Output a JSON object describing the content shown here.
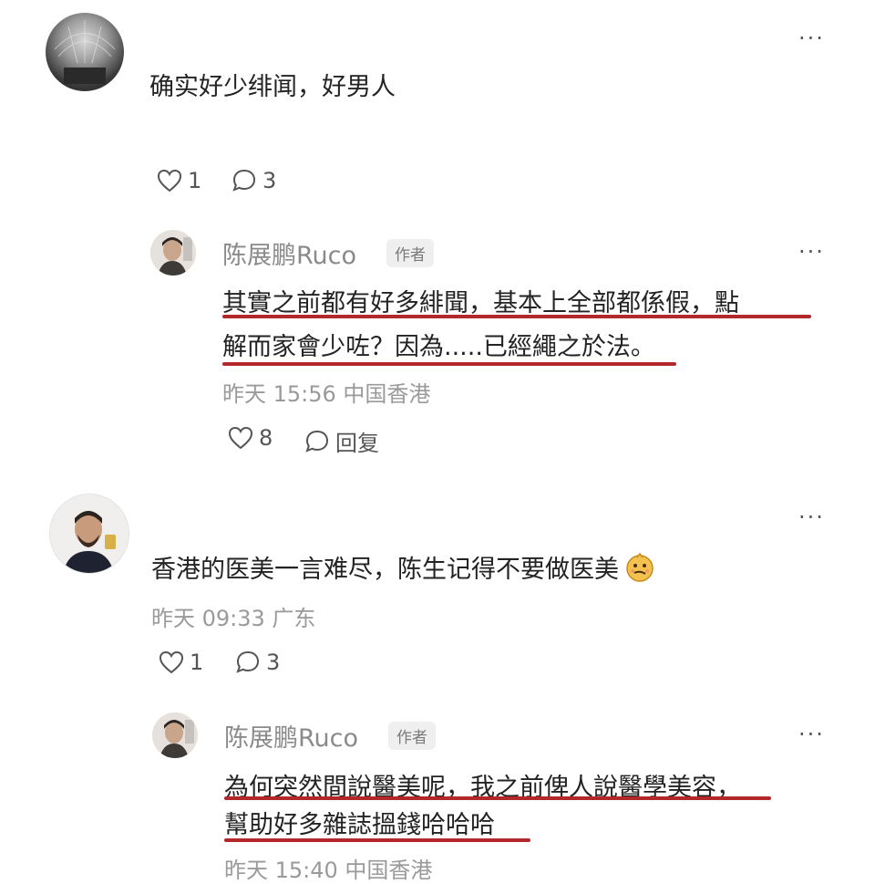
{
  "comments": [
    {
      "text": "确实好少绯闻，好男人",
      "likes": "1",
      "replies": "3",
      "more": "···",
      "reply": {
        "author": "陈展鹏Ruco",
        "badge": "作者",
        "line1": "其實之前都有好多緋聞，基本上全部都係假，點",
        "line2": "解而家會少咗？因為.....已經繩之於法。",
        "time": "昨天 15:56 中国香港",
        "likes": "8",
        "reply_label": "回复",
        "more": "···"
      }
    },
    {
      "text": "香港的医美一言难尽，陈生记得不要做医美",
      "time": "昨天 09:33 广东",
      "likes": "1",
      "replies": "3",
      "more": "···",
      "reply": {
        "author": "陈展鹏Ruco",
        "badge": "作者",
        "line1": "為何突然間說醫美呢，我之前俾人說醫學美容，",
        "line2": "幫助好多雜誌搵錢哈哈哈",
        "time": "昨天 15:40 中国香港",
        "more": "···"
      }
    }
  ],
  "colors": {
    "underline": "#b3282a",
    "meta": "#9a9a9a"
  }
}
